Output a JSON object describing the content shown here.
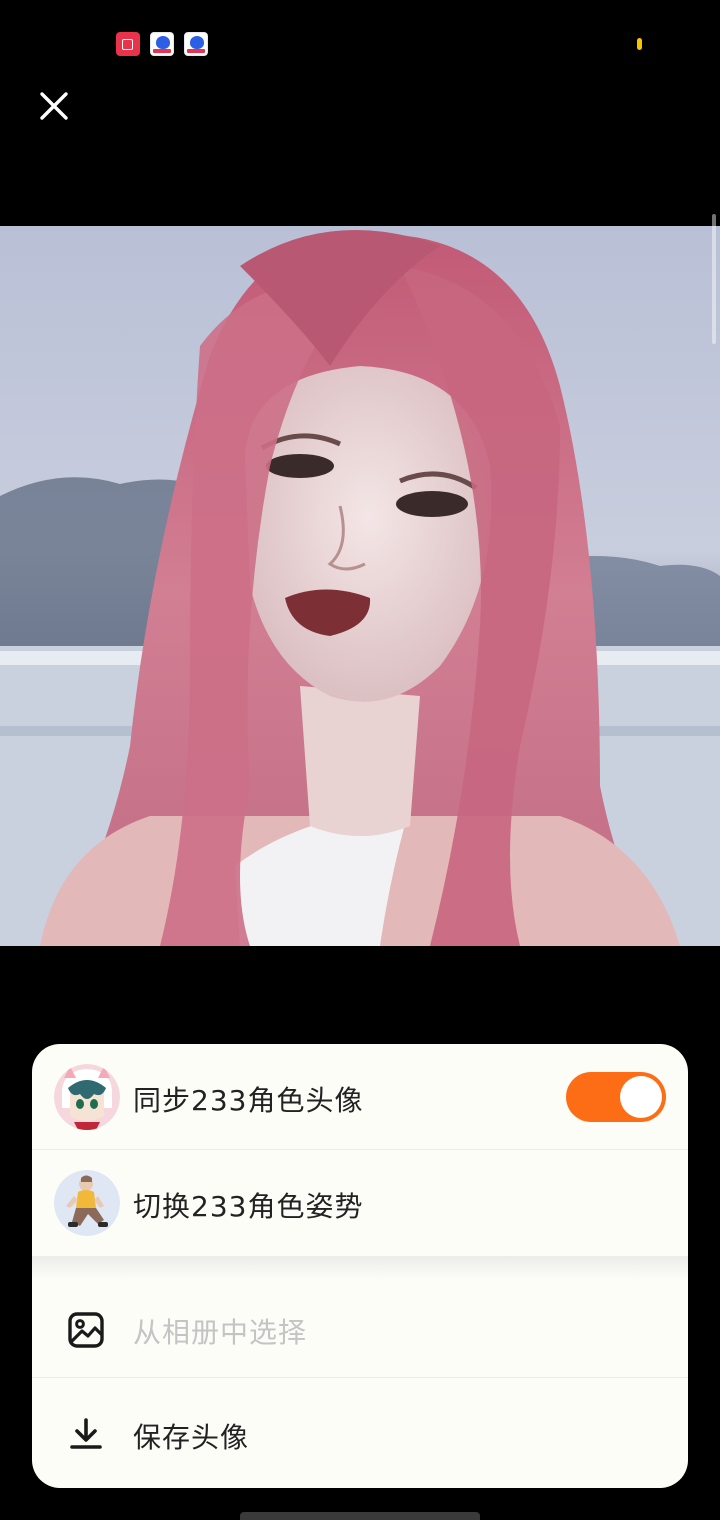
{
  "status_bar": {
    "icons": [
      "screen-record-icon",
      "baidu-app-icon",
      "baidu-app-icon"
    ],
    "indicator_color": "#f5c400"
  },
  "close_button": {
    "icon": "close-icon",
    "color": "#ffffff"
  },
  "photo": {
    "description_icon": "profile-photo"
  },
  "sheet": {
    "sync_avatar": {
      "label": "同步233角色头像",
      "toggle_on": true,
      "toggle_color": "#fd6d15"
    },
    "switch_pose": {
      "label": "切换233角色姿势"
    },
    "choose_album": {
      "label": "从相册中选择",
      "icon": "image-icon"
    },
    "save_avatar": {
      "label": "保存头像",
      "icon": "download-icon"
    }
  }
}
